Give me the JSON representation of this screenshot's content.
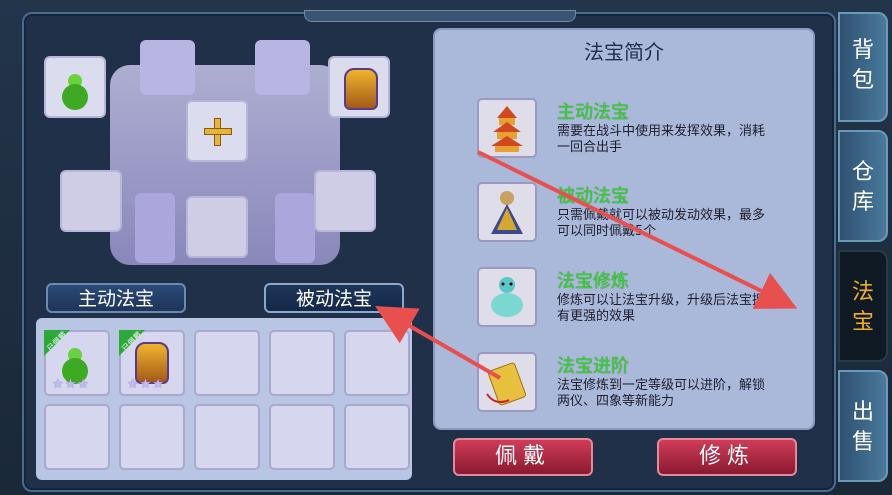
{
  "info_panel": {
    "title": "法宝简介",
    "rows": [
      {
        "title": "主动法宝",
        "desc": "需要在战斗中使用来发挥效果，消耗一回合出手",
        "icon": "pagoda-icon"
      },
      {
        "title": "被动法宝",
        "desc": "只需佩戴就可以被动发动效果，最多可以同时佩戴5个",
        "icon": "warrior-figure-icon"
      },
      {
        "title": "法宝修炼",
        "desc": "修炼可以让法宝升级，升级后法宝拥有更强的效果",
        "icon": "spirit-figure-icon"
      },
      {
        "title": "法宝进阶",
        "desc": "法宝修炼到一定等级可以进阶，解锁两仪、四象等新能力",
        "icon": "golden-token-icon"
      }
    ]
  },
  "buttons": {
    "wear": "佩戴",
    "refine": "修炼"
  },
  "tabs": {
    "active_treasure": "主动法宝",
    "passive_treasure": "被动法宝"
  },
  "side_tabs": [
    {
      "label": "背包"
    },
    {
      "label": "仓库"
    },
    {
      "label": "法宝",
      "active": true
    },
    {
      "label": "出售"
    }
  ],
  "inventory": {
    "equipped_badge": "已佩戴",
    "stars": "★★★",
    "items": [
      {
        "icon": "green-gourd-icon",
        "equipped": true,
        "stars": 3
      },
      {
        "icon": "golden-warrior-icon",
        "equipped": true,
        "stars": 3
      }
    ]
  },
  "colors": {
    "accent_green": "#34d52c",
    "button_red": "#c8344f",
    "active_tab_text": "#f0b020",
    "arrow_red": "#e85050"
  }
}
